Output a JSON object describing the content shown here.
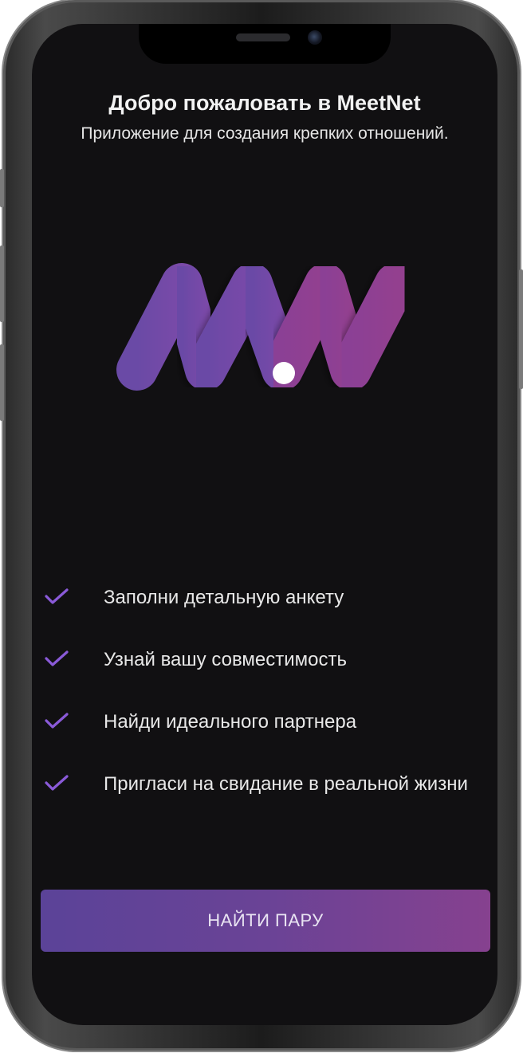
{
  "header": {
    "title": "Добро пожаловать в MeetNet",
    "subtitle": "Приложение для создания крепких отношений."
  },
  "logo": {
    "icon": "meetnet-logo",
    "colors": {
      "purple": "#6f4ba8",
      "magenta": "#8e3f93",
      "dot": "#ffffff"
    }
  },
  "features": [
    {
      "label": "Заполни детальную анкету"
    },
    {
      "label": "Узнай вашу совместимость"
    },
    {
      "label": "Найди идеального партнера"
    },
    {
      "label": "Пригласи на свидание в реальной жизни"
    }
  ],
  "cta": {
    "label": "НАЙТИ ПАРУ"
  },
  "theme": {
    "background": "#111012",
    "accent": "#7a49c4",
    "check_color": "#8a5ad8"
  }
}
